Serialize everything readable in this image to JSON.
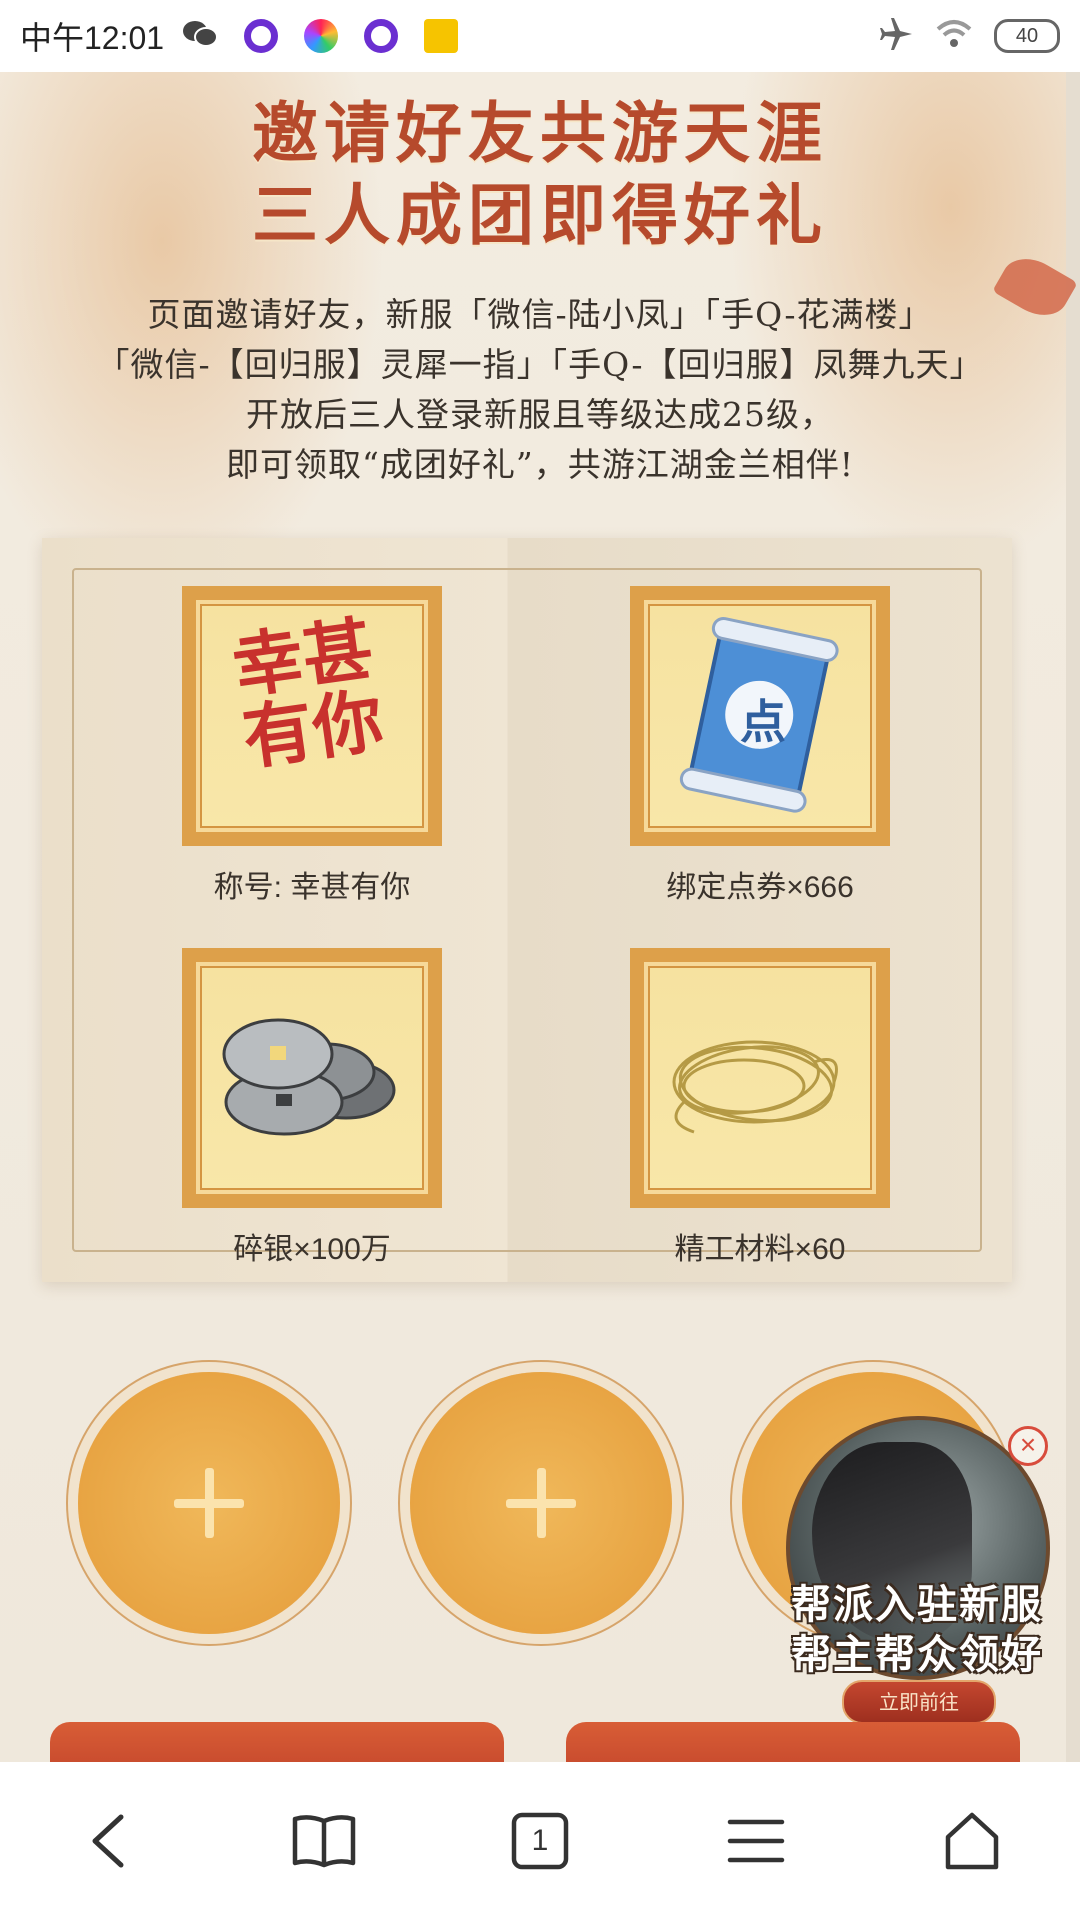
{
  "status_bar": {
    "time": "中午12:01",
    "battery": "40",
    "icons": [
      "wechat-icon",
      "app-ring-icon",
      "app-flower-icon",
      "app-ring-icon",
      "app-seven-icon",
      "airplane-icon",
      "wifi-icon",
      "battery-icon"
    ]
  },
  "header": {
    "title_line1": "邀请好友共游天涯",
    "title_line2": "三人成团即得好礼"
  },
  "description": {
    "line1": "页面邀请好友，新服「微信-陆小凤」「手Q-花满楼」",
    "line2": "「微信-【回归服】灵犀一指」「手Q-【回归服】凤舞九天」",
    "line3": "开放后三人登录新服且等级达成25级，",
    "line4": "即可领取“成团好礼”，共游江湖金兰相伴!"
  },
  "rewards": [
    {
      "label": "称号: 幸甚有你",
      "icon": "title-calligraphy-icon",
      "art_text": "幸甚有你"
    },
    {
      "label": "绑定点券×666",
      "icon": "scroll-icon",
      "art_text": "点"
    },
    {
      "label": "碎银×100万",
      "icon": "silver-coins-icon"
    },
    {
      "label": "精工材料×60",
      "icon": "thread-material-icon"
    }
  ],
  "invite_slots": [
    {
      "icon": "plus-icon"
    },
    {
      "icon": "plus-icon"
    },
    {
      "icon": "plus-icon"
    }
  ],
  "promo": {
    "line1": "帮派入驻新服",
    "line2": "帮主帮众领好礼",
    "button": "立即前往",
    "close": "×"
  },
  "browser_nav": {
    "tab_count": "1",
    "buttons": [
      "back-icon",
      "bookmarks-icon",
      "tabs-icon",
      "menu-icon",
      "home-icon"
    ]
  }
}
